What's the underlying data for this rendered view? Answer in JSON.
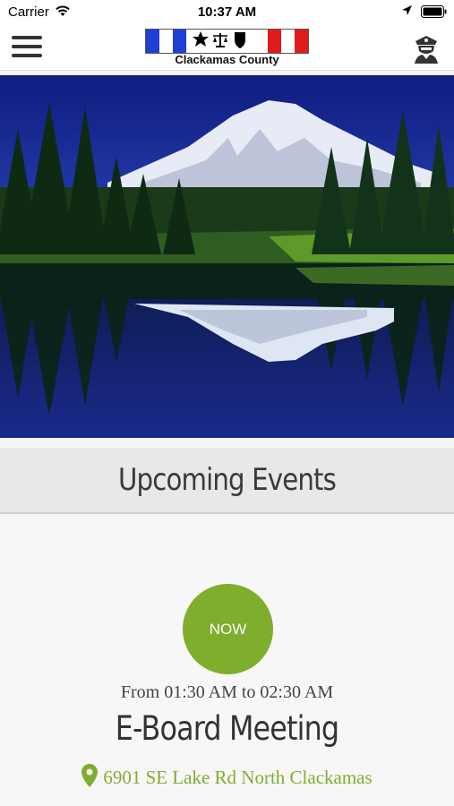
{
  "status_bar": {
    "carrier": "Carrier",
    "time": "10:37 AM"
  },
  "nav": {
    "logo_text": "Clackamas County",
    "logo_stripe_colors": [
      "#1f3fd6",
      "#ffffff",
      "#1f3fd6",
      "#ffffff",
      "#ffffff",
      "#ffffff",
      "#ffffff",
      "#ffffff",
      "#ffffff",
      "#e11b1b",
      "#ffffff",
      "#e11b1b"
    ],
    "menu_icon": "hamburger-menu-icon",
    "officer_icon": "police-officer-icon"
  },
  "hero": {
    "image": "mountain-lake-reflection-photo"
  },
  "events": {
    "section_title": "Upcoming Events",
    "items": [
      {
        "badge": "NOW",
        "time_range": "From 01:30 AM to 02:30 AM",
        "name": "E-Board Meeting",
        "location": "6901 SE Lake Rd North Clackamas"
      }
    ]
  },
  "colors": {
    "accent_green": "#7fad2c",
    "header_band": "#e8e8ea",
    "title_text": "#3a3a3a"
  }
}
